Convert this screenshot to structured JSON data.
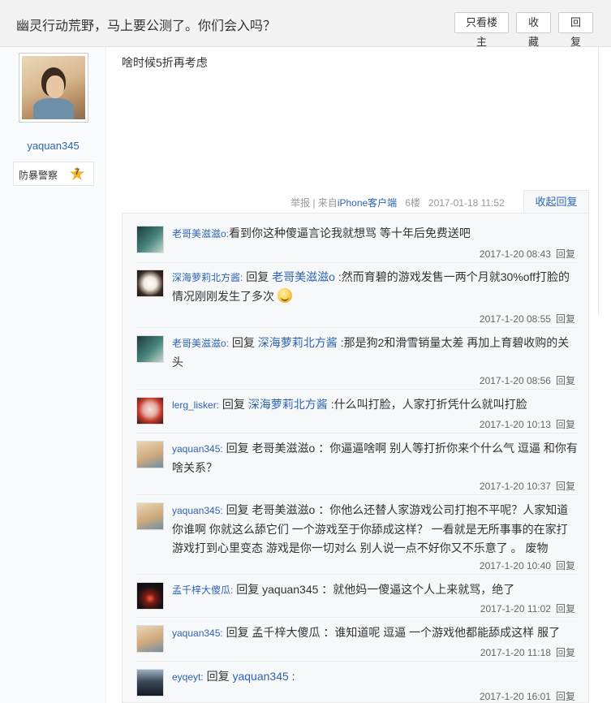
{
  "header": {
    "title": "幽灵行动荒野，马上要公测了。你们会入吗？",
    "only_op_label": "只看楼主",
    "favorite_label": "收藏",
    "reply_label": "回复"
  },
  "author": {
    "name": "yaquan345",
    "rank_name": "防暴警察",
    "rank_level": "7"
  },
  "post": {
    "content": "啥时候5折再考虑",
    "report_label": "举报",
    "source_prefix": "| 来自",
    "source_link": "iPhone客户端",
    "floor": "6楼",
    "time": "2017-01-18 11:52",
    "collapse_label": "收起回复"
  },
  "replies": [
    {
      "user": "老哥美滋滋o:",
      "reply_word": "",
      "target": "",
      "text": "看到你这种傻逼言论我就想骂 等十年后免费送吧",
      "time": "2017-1-20 08:43",
      "reply_btn": "回复",
      "avatar": "avatar-icon"
    },
    {
      "user": "深海萝莉北方酱:",
      "reply_word": "回复",
      "target": "老哥美滋滋o",
      "text": ":然而育碧的游戏发售一两个月就30%off打脸的情况刚刚发生了多次",
      "time": "2017-1-20 08:55",
      "reply_btn": "回复",
      "avatar": "avatar-icon",
      "emoji": "smile-emoji"
    },
    {
      "user": "老哥美滋滋o:",
      "reply_word": "回复",
      "target": "深海萝莉北方酱",
      "text": ":那是狗2和滑雪销量太差 再加上育碧收购的关头",
      "time": "2017-1-20 08:56",
      "reply_btn": "回复",
      "avatar": "avatar-icon"
    },
    {
      "user": "lerg_lisker:",
      "reply_word": "回复",
      "target": "深海萝莉北方酱",
      "text": ":什么叫打脸，人家打折凭什么就叫打脸",
      "time": "2017-1-20 10:13",
      "reply_btn": "回复",
      "avatar": "avatar-icon"
    },
    {
      "user": "yaquan345:",
      "reply_word": "回复",
      "target": "",
      "text": "老哥美滋滋o ：你逼逼啥啊 别人等打折你来个什么气 逗逼 和你有啥关系？",
      "time": "2017-1-20 10:37",
      "reply_btn": "回复",
      "avatar": "avatar-icon"
    },
    {
      "user": "yaquan345:",
      "reply_word": "回复",
      "target": "",
      "text": "老哥美滋滋o ：你他么还替人家游戏公司打抱不平呢？人家知道你谁啊 你就这么舔它们 一个游戏至于你舔成这样？ 一看就是无所事事的在家打游戏打到心里变态 游戏是你一切对么 别人说一点不好你又不乐意了 。 废物",
      "time": "2017-1-20 10:40",
      "reply_btn": "回复",
      "avatar": "avatar-icon"
    },
    {
      "user": "孟千梓大傻瓜:",
      "reply_word": "回复",
      "target": "",
      "text": "yaquan345 ：就他妈一傻逼这个人上来就骂，绝了",
      "time": "2017-1-20 11:02",
      "reply_btn": "回复",
      "avatar": "avatar-icon"
    },
    {
      "user": "yaquan345:",
      "reply_word": "回复",
      "target": "",
      "text": "孟千梓大傻瓜 ：谁知道呢 逗逼 一个游戏他都能舔成这样 服了",
      "time": "2017-1-20 11:18",
      "reply_btn": "回复",
      "avatar": "avatar-icon"
    },
    {
      "user": "eyqeyt:",
      "reply_word": "回复",
      "target": "yaquan345",
      "text": " :",
      "time": "2017-1-20 16:01",
      "reply_btn": "回复",
      "avatar": "avatar-icon"
    }
  ]
}
